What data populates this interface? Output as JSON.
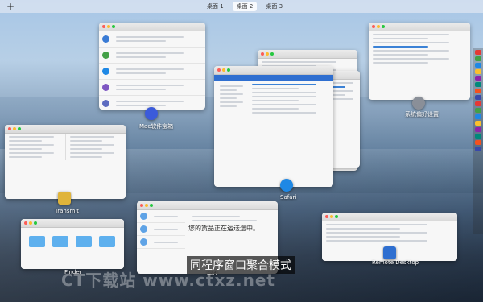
{
  "top_bar": {
    "add_label": "+",
    "desktops": [
      "桌面 1",
      "桌面 2",
      "桌面 3"
    ],
    "active_index": 1
  },
  "windows": {
    "mac_store": {
      "label": "Mac软件宝箱"
    },
    "safari": {
      "label": "Safari"
    },
    "system_prefs": {
      "label": "系统偏好设置"
    },
    "transmit": {
      "label": "Transmit"
    },
    "finder": {
      "label": "Finder"
    },
    "mail": {
      "label": "邮件",
      "headline": "您的货品正在运送途中。"
    },
    "remote_desktop": {
      "label": "Remote Desktop"
    }
  },
  "caption": "同程序窗口聚合模式",
  "watermark": "CT下载站 www.ctxz.net",
  "colors": {
    "mac_store_icon": "#3b5bdb",
    "safari_icon": "#1e88e5",
    "system_prefs_icon": "#8a8f98",
    "remote_desktop_icon": "#2f6fd0"
  }
}
